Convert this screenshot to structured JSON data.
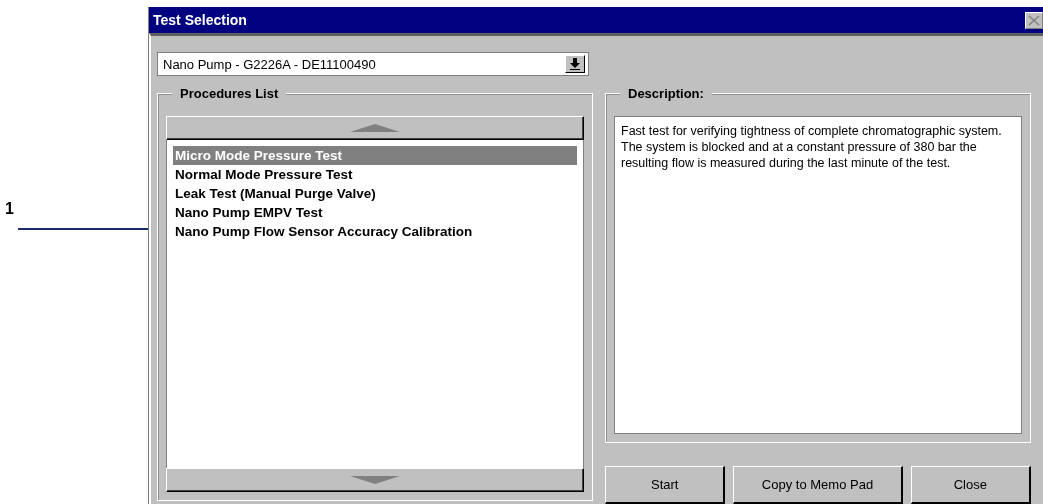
{
  "callout": {
    "label": "1"
  },
  "window": {
    "title": "Test Selection"
  },
  "module_select": {
    "value": "Nano Pump - G2226A - DE11100490"
  },
  "procedures": {
    "title": "Procedures List",
    "items": [
      {
        "label": "Micro Mode Pressure Test",
        "selected": true
      },
      {
        "label": "Normal Mode Pressure Test",
        "selected": false
      },
      {
        "label": "Leak Test (Manual Purge Valve)",
        "selected": false
      },
      {
        "label": "Nano Pump EMPV Test",
        "selected": false
      },
      {
        "label": "Nano Pump Flow Sensor Accuracy Calibration",
        "selected": false
      }
    ]
  },
  "description": {
    "title": "Description:",
    "text": "Fast test for verifying tightness of complete chromatographic system. The system is blocked and at a constant pressure of 380 bar the resulting flow is measured during the last minute of the test."
  },
  "buttons": [
    "Start",
    "Copy to Memo Pad",
    "Close"
  ]
}
